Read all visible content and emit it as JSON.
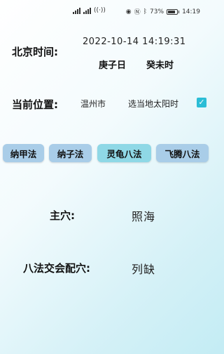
{
  "status_bar": {
    "battery": "73%",
    "time": "14:19"
  },
  "beijing_time": {
    "label": "北京时间:",
    "datetime": "2022-10-14 14:19:31",
    "day_ganzhi": "庚子日",
    "hour_ganzhi": "癸未时"
  },
  "location": {
    "label": "当前位置:",
    "city": "温州市",
    "solar_time_label": "选当地太阳时",
    "solar_time_checked": true
  },
  "methods": [
    {
      "label": "纳甲法"
    },
    {
      "label": "纳子法"
    },
    {
      "label": "灵龟八法"
    },
    {
      "label": "飞腾八法"
    }
  ],
  "main_point": {
    "label": "主穴:",
    "value": "照海"
  },
  "paired_point": {
    "label": "八法交会配穴:",
    "value": "列缺"
  }
}
